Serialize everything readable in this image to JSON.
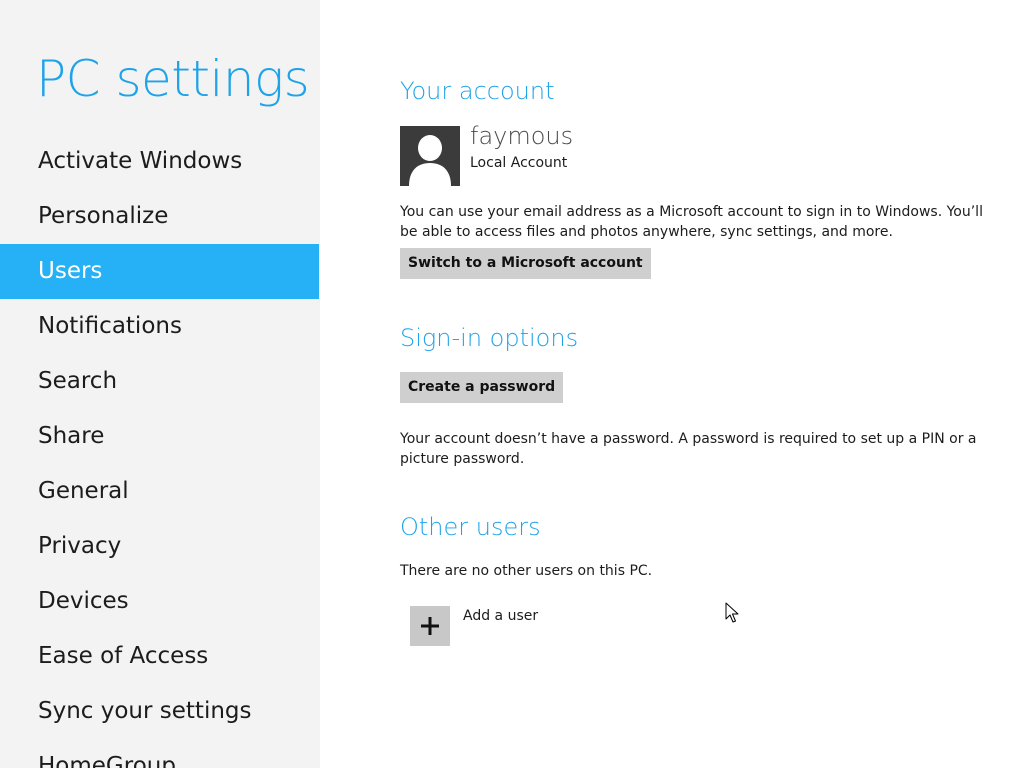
{
  "sidebar": {
    "title": "PC settings",
    "items": [
      {
        "label": "Activate Windows"
      },
      {
        "label": "Personalize"
      },
      {
        "label": "Users",
        "selected": true
      },
      {
        "label": "Notifications"
      },
      {
        "label": "Search"
      },
      {
        "label": "Share"
      },
      {
        "label": "General"
      },
      {
        "label": "Privacy"
      },
      {
        "label": "Devices"
      },
      {
        "label": "Ease of Access"
      },
      {
        "label": "Sync your settings"
      },
      {
        "label": "HomeGroup"
      }
    ]
  },
  "account": {
    "heading": "Your account",
    "avatar_icon": "user-silhouette-icon",
    "user_name": "faymous",
    "account_type": "Local Account",
    "description": "You can use your email address as a Microsoft account to sign in to Windows. You’ll be able to access files and photos anywhere, sync settings, and more.",
    "switch_button_label": "Switch to a Microsoft account"
  },
  "signin": {
    "heading": "Sign-in options",
    "create_password_label": "Create a password",
    "note": "Your account doesn’t have a password. A password is required to set up a PIN or a picture password."
  },
  "other_users": {
    "heading": "Other users",
    "status": "There are no other users on this PC.",
    "add_user_icon": "plus-icon",
    "add_user_label": "Add a user"
  },
  "colors": {
    "accent": "#1fa3e8",
    "selected_nav": "#26b0f6",
    "sidebar_bg": "#f3f3f3",
    "button_bg": "#cfcfcf"
  }
}
